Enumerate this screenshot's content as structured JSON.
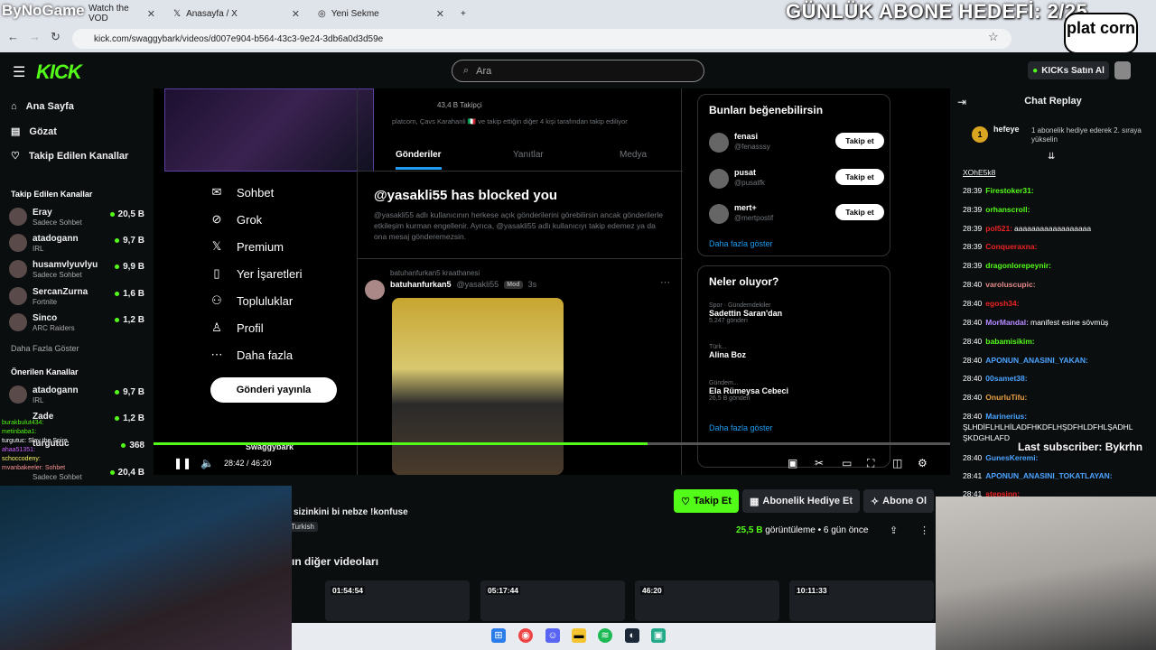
{
  "browser": {
    "tabs": [
      {
        "label": "Watch the VOD",
        "active": false
      },
      {
        "label": "Anasayfa / X",
        "active": false
      },
      {
        "label": "Yeni Sekme",
        "active": false
      }
    ],
    "url": "kick.com/swaggybark/videos/d007e904-b564-43c3-9e24-3db6a0d3d59e"
  },
  "overlay": {
    "bynogame": "ByNoGame",
    "daily_goal": "GÜNLÜK ABONE HEDEFİ: 2/25",
    "platcorn": "plat corn",
    "last_subscriber": "Last subscriber: Bykrhn"
  },
  "kick": {
    "logo": "KICK",
    "search_placeholder": "Ara",
    "kicks_button": "KICKs Satın Al",
    "nav": [
      {
        "label": "Ana Sayfa",
        "icon": "home-icon"
      },
      {
        "label": "Gözat",
        "icon": "browse-icon"
      },
      {
        "label": "Takip Edilen Kanallar",
        "icon": "heart-icon"
      }
    ],
    "followed_title": "Takip Edilen Kanallar",
    "followed": [
      {
        "name": "Eray",
        "sub": "Sadece Sohbet",
        "viewers": "20,5 B"
      },
      {
        "name": "atadogann",
        "sub": "IRL",
        "viewers": "9,7 B"
      },
      {
        "name": "husamvlyuvlyu",
        "sub": "Sadece Sohbet",
        "viewers": "9,9 B"
      },
      {
        "name": "SercanZurna",
        "sub": "Fortnite",
        "viewers": "1,6 B"
      },
      {
        "name": "Sinco",
        "sub": "ARC Raiders",
        "viewers": "1,2 B"
      }
    ],
    "more_link": "Daha Fazla Göster",
    "recommended_title": "Önerilen Kanallar",
    "recommended": [
      {
        "name": "atadogann",
        "sub": "IRL",
        "viewers": "9,7 B"
      },
      {
        "name": "Zade",
        "sub": "",
        "viewers": "1,2 B"
      },
      {
        "name": "turgutuc",
        "sub": "",
        "viewers": "368"
      },
      {
        "name": "",
        "sub": "Sadece Sohbet",
        "viewers": "20,4 B"
      }
    ]
  },
  "x_page": {
    "followers_line": "43,4 B Takipçi",
    "follow_info": "platcorn, Çavs Karahanli 🇮🇹 ve takip ettiğin diğer 4 kişi tarafından takip ediliyor",
    "nav": [
      {
        "label": "Sohbet",
        "icon": "mail-icon"
      },
      {
        "label": "Grok",
        "icon": "grok-icon"
      },
      {
        "label": "Premium",
        "icon": "x-premium-icon"
      },
      {
        "label": "Yer İşaretleri",
        "icon": "bookmark-icon"
      },
      {
        "label": "Topluluklar",
        "icon": "communities-icon"
      },
      {
        "label": "Profil",
        "icon": "profile-icon"
      },
      {
        "label": "Daha fazla",
        "icon": "more-icon"
      }
    ],
    "post_button": "Gönderi yayınla",
    "tabs": [
      "Gönderiler",
      "Yanıtlar",
      "Medya"
    ],
    "blocked_title": "@yasakli55 has blocked you",
    "blocked_text": "@yasakli55 adlı kullanıcının herkese açık gönderilerini görebilirsin ancak gönderilerle etkileşim kurman engellenir. Ayrıca, @yasakli55 adlı kullanıcıyı takip edemez ya da ona mesaj gönderemezsin.",
    "repost_meta": "batuhanfurkan5 kraathanesi",
    "tweet_author": "batuhanfurkan5",
    "tweet_handle": "@yasakli55",
    "tweet_badge": "Mod",
    "tweet_time": "3s",
    "suggest_title": "Bunları beğenebilirsin",
    "suggestions": [
      {
        "name": "fenasi",
        "handle": "@fenasssy",
        "button": "Takip et"
      },
      {
        "name": "pusat",
        "handle": "@pusatfk",
        "button": "Takip et"
      },
      {
        "name": "mert+",
        "handle": "@mertpostif",
        "button": "Takip et"
      }
    ],
    "suggest_more": "Daha fazla göster",
    "trends_title": "Neler oluyor?",
    "trends": [
      {
        "cat": "Spor · Gündemdekiler",
        "title": "Sadettin Saran'dan",
        "count": "5.247 gönderi"
      },
      {
        "cat": "Türk...",
        "title": "Alina Boz",
        "count": ""
      },
      {
        "cat": "Gündem...",
        "title": "Ela Rümeysa Cebeci",
        "count": "26,5 B gönderi"
      }
    ],
    "trends_more": "Daha fazla göster",
    "bottom_name": "Swaggybark"
  },
  "player": {
    "time": "28:42 / 46:20",
    "progress": 0.62
  },
  "chat": {
    "title": "Chat Replay",
    "pinned_user": "hefeye",
    "pinned_badge": "1",
    "pinned_msg": "1 abonelik hediye ederek 2. sıraya yükselin",
    "first_user": "XOhE5k8",
    "messages": [
      {
        "t": "28:39",
        "u": "Firestoker31:",
        "m": "",
        "c": "#53fc18"
      },
      {
        "t": "28:39",
        "u": "orhanscroll:",
        "m": "",
        "c": "#53fc18"
      },
      {
        "t": "28:39",
        "u": "pol521:",
        "m": "aaaaaaaaaaaaaaaaaa",
        "c": "#e22"
      },
      {
        "t": "28:39",
        "u": "Conqueraxna:",
        "m": "",
        "c": "#e22"
      },
      {
        "t": "28:39",
        "u": "dragonlorepeynir:",
        "m": "",
        "c": "#53fc18"
      },
      {
        "t": "28:40",
        "u": "varoluscupic:",
        "m": "",
        "c": "#e58a8a"
      },
      {
        "t": "28:40",
        "u": "egosh34:",
        "m": "",
        "c": "#e22"
      },
      {
        "t": "28:40",
        "u": "MorMandal:",
        "m": "manifest esine sövmüş",
        "c": "#b58aff"
      },
      {
        "t": "28:40",
        "u": "babamisikim:",
        "m": "",
        "c": "#53fc18"
      },
      {
        "t": "28:40",
        "u": "APONUN_ANASINI_YAKAN:",
        "m": "",
        "c": "#4aa3ff"
      },
      {
        "t": "28:40",
        "u": "00samet38:",
        "m": "",
        "c": "#4aa3ff"
      },
      {
        "t": "28:40",
        "u": "OnurluTifu:",
        "m": "",
        "c": "#e8a040"
      },
      {
        "t": "28:40",
        "u": "Marinerius:",
        "m": "",
        "c": "#4aa3ff"
      },
      {
        "t": "",
        "u": "",
        "m": "ŞLHDİFLHLHİLADFHKDFLHŞDFHLDFHLŞADHL",
        "c": "#fff"
      },
      {
        "t": "",
        "u": "",
        "m": "ŞKDGHLAFD",
        "c": "#fff"
      },
      {
        "t": "28:40",
        "u": "GunesKeremi:",
        "m": "",
        "c": "#4aa3ff"
      },
      {
        "t": "28:41",
        "u": "APONUN_ANASINI_TOKATLAYAN:",
        "m": "",
        "c": "#4aa3ff"
      },
      {
        "t": "28:41",
        "u": "stepsinn:",
        "m": "",
        "c": "#e22"
      }
    ]
  },
  "below": {
    "title": "sizinkini bi nebze !konfuse",
    "category": "Turkish",
    "follow": "Takip Et",
    "gift": "Abonelik Hediye Et",
    "subscribe": "Abone Ol",
    "views_num": "25,5 B",
    "views_label": "görüntüleme",
    "ago": "6 gün önce",
    "other_title": "ın diğer videoları",
    "thumbs": [
      "01:54:54",
      "05:17:44",
      "46:20",
      "10:11:33"
    ]
  },
  "stream_chat": [
    "burakbulut434: ",
    "metinbaba1: ",
    "turgutuc: Slay the Spire",
    "ahaa51351: ",
    "schoccodeny: ",
    "mvanbakeeler: Sohbet"
  ],
  "colors": {
    "kick_green": "#53fc18",
    "bg": "#0b0e0f",
    "panel": "#24272c"
  }
}
